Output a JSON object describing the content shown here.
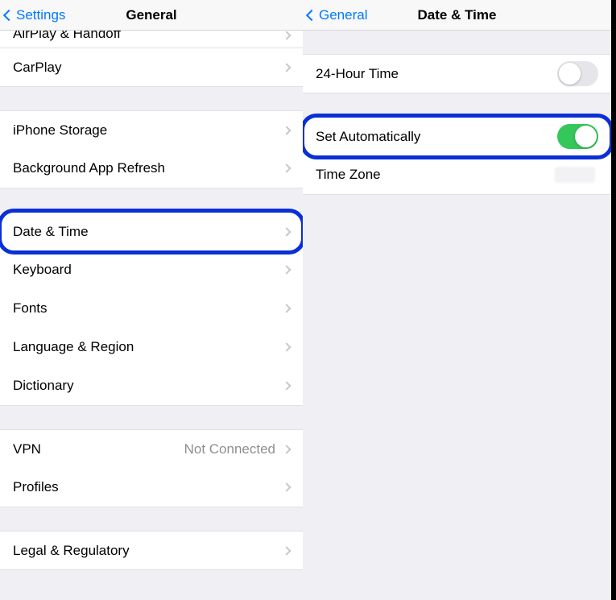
{
  "left": {
    "back_label": "Settings",
    "title": "General",
    "rows": {
      "airplay": "AirPlay & Handoff",
      "carplay": "CarPlay",
      "storage": "iPhone Storage",
      "bgrefresh": "Background App Refresh",
      "datetime": "Date & Time",
      "keyboard": "Keyboard",
      "fonts": "Fonts",
      "langregion": "Language & Region",
      "dictionary": "Dictionary",
      "vpn": "VPN",
      "vpn_value": "Not Connected",
      "profiles": "Profiles",
      "legal": "Legal & Regulatory"
    }
  },
  "right": {
    "back_label": "General",
    "title": "Date & Time",
    "rows": {
      "hour24": "24-Hour Time",
      "setauto": "Set Automatically",
      "timezone": "Time Zone"
    },
    "toggles": {
      "hour24": false,
      "setauto": true
    }
  }
}
